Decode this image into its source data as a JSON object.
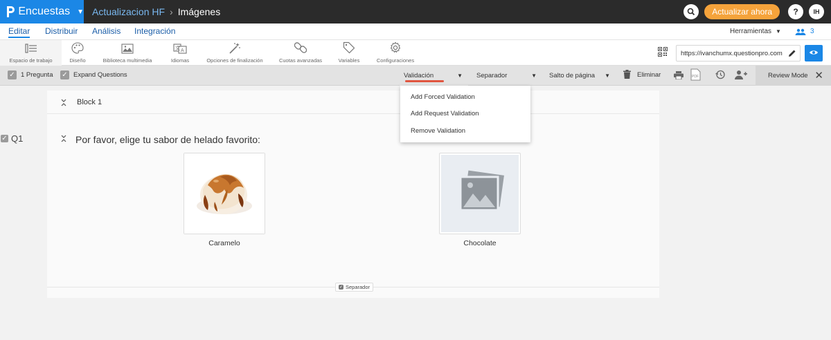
{
  "topbar": {
    "brand": "Encuestas",
    "breadcrumb_project": "Actualizacion HF",
    "breadcrumb_page": "Imágenes",
    "upgrade_label": "Actualizar ahora",
    "help_label": "?",
    "avatar_initials": "IH"
  },
  "menu": {
    "items": [
      "Editar",
      "Distribuir",
      "Análisis",
      "Integración"
    ],
    "tools_label": "Herramientas",
    "collaborators_count": "3"
  },
  "iconbar": {
    "items": [
      "Espacio de trabajo",
      "Diseño",
      "Biblioteca multimedia",
      "Idiomas",
      "Opciones de finalización",
      "Cuotas avanzadas",
      "Variables",
      "Configuraciones"
    ],
    "survey_url": "https://ivanchumx.questionpro.com"
  },
  "actionbar": {
    "question_count": "1 Pregunta",
    "expand_label": "Expand Questions",
    "validation_label": "Validación",
    "separator_label": "Separador",
    "page_break_label": "Salto de página",
    "delete_label": "Eliminar",
    "review_mode_label": "Review Mode"
  },
  "validation_menu": {
    "items": [
      "Add Forced Validation",
      "Add Request Validation",
      "Remove Validation"
    ]
  },
  "survey": {
    "block_title": "Block 1",
    "question_number": "Q1",
    "question_text": "Por favor, elige tu sabor de helado favorito:",
    "options": [
      "Caramelo",
      "Chocolate"
    ],
    "separator_chip": "Separador"
  },
  "colors": {
    "brand_blue": "#1b87e6",
    "topbar_bg": "#2b2b2b",
    "upgrade_orange": "#f5a33b",
    "validation_underline": "#e0553f"
  }
}
